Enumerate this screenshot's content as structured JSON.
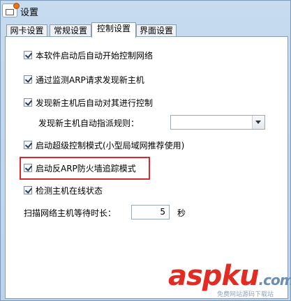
{
  "window": {
    "title": "设置"
  },
  "tabs": [
    {
      "label": "网卡设置"
    },
    {
      "label": "常规设置"
    },
    {
      "label": "控制设置"
    },
    {
      "label": "界面设置"
    }
  ],
  "active_tab": "控制设置",
  "options": {
    "auto_control": {
      "label": "本软件启动后自动开始控制网络",
      "checked": true
    },
    "arp_discover": {
      "label": "通过监测ARP请求发现新主机",
      "checked": true
    },
    "control_new_host": {
      "label": "发现新主机后自动对其进行控制",
      "checked": true
    },
    "super_mode": {
      "label": "启动超级控制模式(小型局域网推荐使用)",
      "checked": true
    },
    "anti_arp_firewall": {
      "label": "启动反ARP防火墙追踪模式",
      "checked": true
    },
    "detect_online": {
      "label": "检测主机在线状态",
      "checked": true
    }
  },
  "assign_rule": {
    "label": "发现新主机自动指派规则：",
    "value": ""
  },
  "scan_wait": {
    "label": "扫描网络主机等待时长：",
    "value": "5",
    "unit": "秒"
  },
  "watermark": {
    "logo": "aspku",
    "tld": ".com",
    "sub": "免费网站源码下载站"
  },
  "colors": {
    "highlight": "#d9282f",
    "window_bg": "#c7dbef"
  }
}
